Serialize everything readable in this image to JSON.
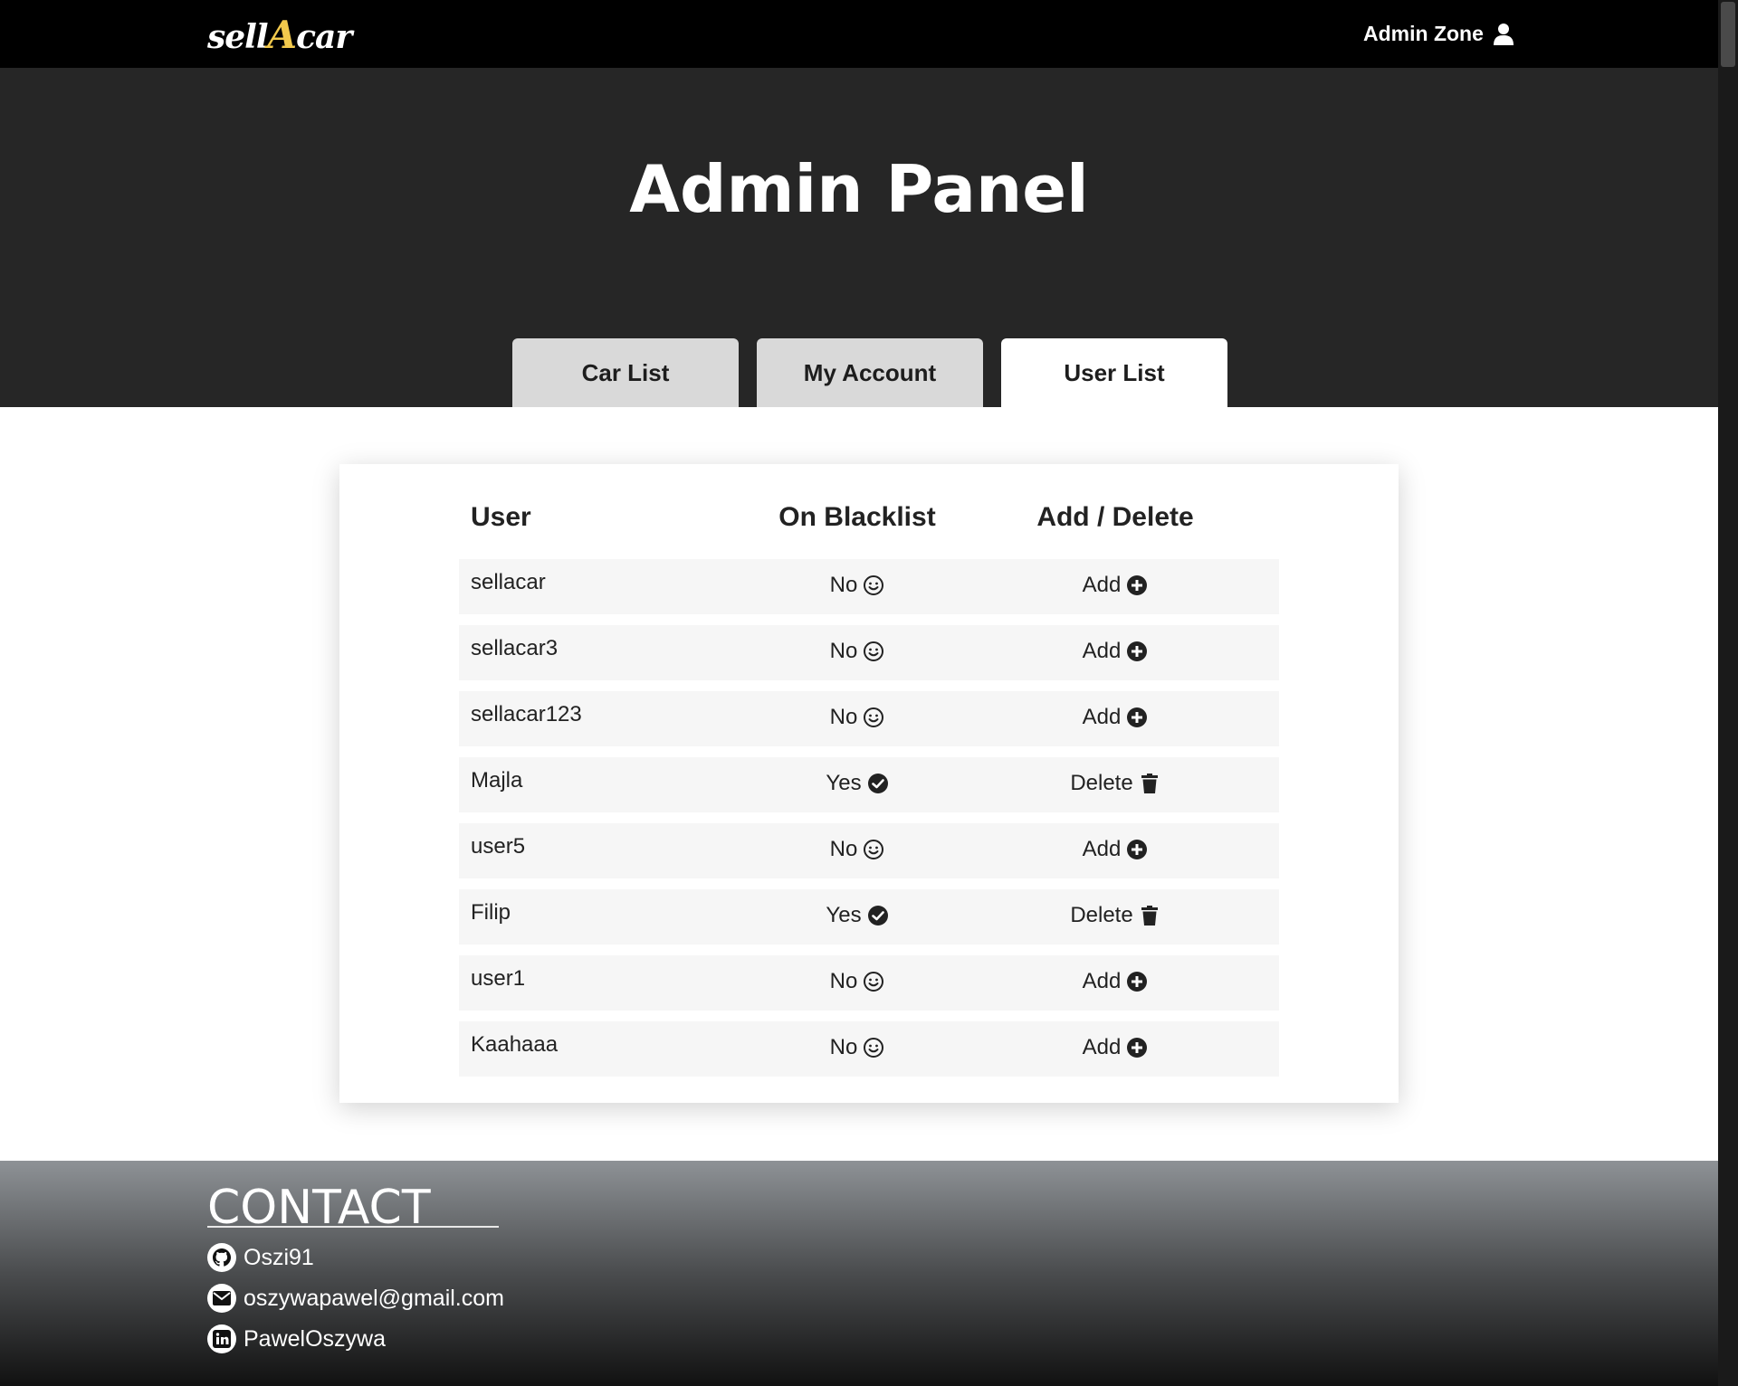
{
  "nav": {
    "logo_prefix": "sell",
    "logo_accent": "A",
    "logo_suffix": "car",
    "admin_zone": "Admin Zone"
  },
  "hero": {
    "title": "Admin Panel",
    "tabs": [
      {
        "label": "Car List",
        "active": false
      },
      {
        "label": "My Account",
        "active": false
      },
      {
        "label": "User List",
        "active": true
      }
    ]
  },
  "table": {
    "headers": {
      "user": "User",
      "blacklist": "On Blacklist",
      "action": "Add / Delete"
    },
    "rows": [
      {
        "user": "sellacar",
        "blacklist": "No",
        "action": "Add"
      },
      {
        "user": "sellacar3",
        "blacklist": "No",
        "action": "Add"
      },
      {
        "user": "sellacar123",
        "blacklist": "No",
        "action": "Add"
      },
      {
        "user": "Majla",
        "blacklist": "Yes",
        "action": "Delete"
      },
      {
        "user": "user5",
        "blacklist": "No",
        "action": "Add"
      },
      {
        "user": "Filip",
        "blacklist": "Yes",
        "action": "Delete"
      },
      {
        "user": "user1",
        "blacklist": "No",
        "action": "Add"
      },
      {
        "user": "Kaahaaa",
        "blacklist": "No",
        "action": "Add"
      }
    ]
  },
  "footer": {
    "title": "CONTACT",
    "github": "Oszi91",
    "email": "oszywapawel@gmail.com",
    "linkedin": "PawelOszywa"
  },
  "colors": {
    "accent": "#f2c94c",
    "navbar": "#000000",
    "hero": "#262626"
  }
}
